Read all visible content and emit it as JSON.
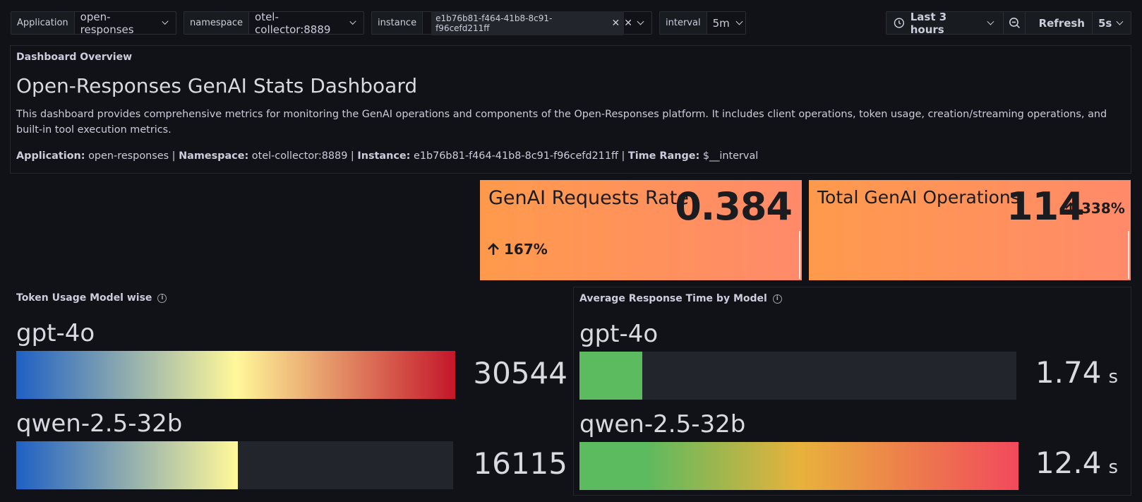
{
  "toolbar": {
    "application": {
      "label": "Application",
      "value": "open-responses"
    },
    "namespace": {
      "label": "namespace",
      "value": "otel-collector:8889"
    },
    "instance": {
      "label": "instance",
      "value": "e1b76b81-f464-41b8-8c91-f96cefd211ff"
    },
    "interval": {
      "label": "interval",
      "value": "5m"
    },
    "time_range": "Last 3 hours",
    "refresh_label": "Refresh",
    "refresh_interval": "5s"
  },
  "overview": {
    "panel_title": "Dashboard Overview",
    "heading": "Open-Responses GenAI Stats Dashboard",
    "description": "This dashboard provides comprehensive metrics for monitoring the GenAI operations and components of the Open-Responses platform. It includes client operations, token usage, creation/streaming operations, and built-in tool execution metrics.",
    "meta": {
      "app_key": "Application:",
      "app_val": " open-responses | ",
      "ns_key": "Namespace:",
      "ns_val": " otel-collector:8889 | ",
      "inst_key": "Instance:",
      "inst_val": " e1b76b81-f464-41b8-8c91-f96cefd211ff | ",
      "time_key": "Time Range:",
      "time_val": " $__interval"
    }
  },
  "stats": [
    {
      "title": "GenAI Requests Rate",
      "value": "0.384",
      "change": "167%"
    },
    {
      "title": "Total GenAI Operations",
      "value": "114",
      "change": "338%"
    }
  ],
  "token_panel": {
    "title": "Token Usage Model wise",
    "rows": [
      {
        "model": "gpt-4o",
        "value": "30544",
        "fraction": 1.0
      },
      {
        "model": "qwen-2.5-32b",
        "value": "16115",
        "fraction": 0.505
      }
    ]
  },
  "response_panel": {
    "title": "Average Response Time by Model",
    "rows": [
      {
        "model": "gpt-4o",
        "value": "1.74",
        "unit": "s",
        "fraction": 0.143
      },
      {
        "model": "qwen-2.5-32b",
        "value": "12.4",
        "unit": "s",
        "fraction": 1.0
      }
    ]
  },
  "colors": {
    "background": "#111217",
    "panel": "#181b1f",
    "stat_orange": "#ff9a4c",
    "bar_green": "#5cba5f",
    "bar_red": "#f2495c"
  },
  "icons": [
    "chevron-down-icon",
    "close-icon",
    "clock-icon",
    "zoom-out-icon",
    "refresh-icon",
    "info-icon",
    "arrow-up-icon"
  ]
}
